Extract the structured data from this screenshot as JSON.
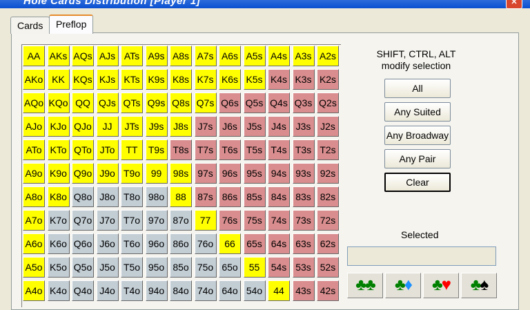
{
  "window": {
    "title": "Hole Cards Distribution [Player 1]",
    "close_glyph": "✕"
  },
  "tabs": [
    {
      "label": "Cards"
    },
    {
      "label": "Preflop"
    }
  ],
  "hint": {
    "line1": "SHIFT, CTRL, ALT",
    "line2": "modify selection"
  },
  "buttons": {
    "all": "All",
    "any_suited": "Any Suited",
    "any_broadway": "Any Broadway",
    "any_pair": "Any Pair",
    "clear": "Clear"
  },
  "selected_label": "Selected",
  "selected_value": "",
  "suit_buttons": [
    {
      "a": "♣",
      "b": "♣",
      "a_color": "#008000",
      "b_color": "#008000"
    },
    {
      "a": "♣",
      "b": "♦",
      "a_color": "#008000",
      "b_color": "#1e90ff"
    },
    {
      "a": "♣",
      "b": "♥",
      "a_color": "#008000",
      "b_color": "#ff0000"
    },
    {
      "a": "♣",
      "b": "♠",
      "a_color": "#008000",
      "b_color": "#000000"
    }
  ],
  "colors": {
    "selected": "#ffff00",
    "suited": "#d98d8e",
    "offsuit": "#c2cdd4"
  },
  "grid": [
    [
      [
        "AA",
        "y"
      ],
      [
        "AKs",
        "y"
      ],
      [
        "AQs",
        "y"
      ],
      [
        "AJs",
        "y"
      ],
      [
        "ATs",
        "y"
      ],
      [
        "A9s",
        "y"
      ],
      [
        "A8s",
        "y"
      ],
      [
        "A7s",
        "y"
      ],
      [
        "A6s",
        "y"
      ],
      [
        "A5s",
        "y"
      ],
      [
        "A4s",
        "y"
      ],
      [
        "A3s",
        "y"
      ],
      [
        "A2s",
        "y"
      ]
    ],
    [
      [
        "AKo",
        "y"
      ],
      [
        "KK",
        "y"
      ],
      [
        "KQs",
        "y"
      ],
      [
        "KJs",
        "y"
      ],
      [
        "KTs",
        "y"
      ],
      [
        "K9s",
        "y"
      ],
      [
        "K8s",
        "y"
      ],
      [
        "K7s",
        "y"
      ],
      [
        "K6s",
        "y"
      ],
      [
        "K5s",
        "y"
      ],
      [
        "K4s",
        "p"
      ],
      [
        "K3s",
        "p"
      ],
      [
        "K2s",
        "p"
      ]
    ],
    [
      [
        "AQo",
        "y"
      ],
      [
        "KQo",
        "y"
      ],
      [
        "QQ",
        "y"
      ],
      [
        "QJs",
        "y"
      ],
      [
        "QTs",
        "y"
      ],
      [
        "Q9s",
        "y"
      ],
      [
        "Q8s",
        "y"
      ],
      [
        "Q7s",
        "y"
      ],
      [
        "Q6s",
        "p"
      ],
      [
        "Q5s",
        "p"
      ],
      [
        "Q4s",
        "p"
      ],
      [
        "Q3s",
        "p"
      ],
      [
        "Q2s",
        "p"
      ]
    ],
    [
      [
        "AJo",
        "y"
      ],
      [
        "KJo",
        "y"
      ],
      [
        "QJo",
        "y"
      ],
      [
        "JJ",
        "y"
      ],
      [
        "JTs",
        "y"
      ],
      [
        "J9s",
        "y"
      ],
      [
        "J8s",
        "y"
      ],
      [
        "J7s",
        "p"
      ],
      [
        "J6s",
        "p"
      ],
      [
        "J5s",
        "p"
      ],
      [
        "J4s",
        "p"
      ],
      [
        "J3s",
        "p"
      ],
      [
        "J2s",
        "p"
      ]
    ],
    [
      [
        "ATo",
        "y"
      ],
      [
        "KTo",
        "y"
      ],
      [
        "QTo",
        "y"
      ],
      [
        "JTo",
        "y"
      ],
      [
        "TT",
        "y"
      ],
      [
        "T9s",
        "y"
      ],
      [
        "T8s",
        "p"
      ],
      [
        "T7s",
        "p"
      ],
      [
        "T6s",
        "p"
      ],
      [
        "T5s",
        "p"
      ],
      [
        "T4s",
        "p"
      ],
      [
        "T3s",
        "p"
      ],
      [
        "T2s",
        "p"
      ]
    ],
    [
      [
        "A9o",
        "y"
      ],
      [
        "K9o",
        "y"
      ],
      [
        "Q9o",
        "y"
      ],
      [
        "J9o",
        "y"
      ],
      [
        "T9o",
        "y"
      ],
      [
        "99",
        "y"
      ],
      [
        "98s",
        "y"
      ],
      [
        "97s",
        "p"
      ],
      [
        "96s",
        "p"
      ],
      [
        "95s",
        "p"
      ],
      [
        "94s",
        "p"
      ],
      [
        "93s",
        "p"
      ],
      [
        "92s",
        "p"
      ]
    ],
    [
      [
        "A8o",
        "y"
      ],
      [
        "K8o",
        "y"
      ],
      [
        "Q8o",
        "g"
      ],
      [
        "J8o",
        "g"
      ],
      [
        "T8o",
        "g"
      ],
      [
        "98o",
        "g"
      ],
      [
        "88",
        "y"
      ],
      [
        "87s",
        "p"
      ],
      [
        "86s",
        "p"
      ],
      [
        "85s",
        "p"
      ],
      [
        "84s",
        "p"
      ],
      [
        "83s",
        "p"
      ],
      [
        "82s",
        "p"
      ]
    ],
    [
      [
        "A7o",
        "y"
      ],
      [
        "K7o",
        "g"
      ],
      [
        "Q7o",
        "g"
      ],
      [
        "J7o",
        "g"
      ],
      [
        "T7o",
        "g"
      ],
      [
        "97o",
        "g"
      ],
      [
        "87o",
        "g"
      ],
      [
        "77",
        "y"
      ],
      [
        "76s",
        "p"
      ],
      [
        "75s",
        "p"
      ],
      [
        "74s",
        "p"
      ],
      [
        "73s",
        "p"
      ],
      [
        "72s",
        "p"
      ]
    ],
    [
      [
        "A6o",
        "y"
      ],
      [
        "K6o",
        "g"
      ],
      [
        "Q6o",
        "g"
      ],
      [
        "J6o",
        "g"
      ],
      [
        "T6o",
        "g"
      ],
      [
        "96o",
        "g"
      ],
      [
        "86o",
        "g"
      ],
      [
        "76o",
        "g"
      ],
      [
        "66",
        "y"
      ],
      [
        "65s",
        "p"
      ],
      [
        "64s",
        "p"
      ],
      [
        "63s",
        "p"
      ],
      [
        "62s",
        "p"
      ]
    ],
    [
      [
        "A5o",
        "y"
      ],
      [
        "K5o",
        "g"
      ],
      [
        "Q5o",
        "g"
      ],
      [
        "J5o",
        "g"
      ],
      [
        "T5o",
        "g"
      ],
      [
        "95o",
        "g"
      ],
      [
        "85o",
        "g"
      ],
      [
        "75o",
        "g"
      ],
      [
        "65o",
        "g"
      ],
      [
        "55",
        "y"
      ],
      [
        "54s",
        "p"
      ],
      [
        "53s",
        "p"
      ],
      [
        "52s",
        "p"
      ]
    ],
    [
      [
        "A4o",
        "y"
      ],
      [
        "K4o",
        "g"
      ],
      [
        "Q4o",
        "g"
      ],
      [
        "J4o",
        "g"
      ],
      [
        "T4o",
        "g"
      ],
      [
        "94o",
        "g"
      ],
      [
        "84o",
        "g"
      ],
      [
        "74o",
        "g"
      ],
      [
        "64o",
        "g"
      ],
      [
        "54o",
        "g"
      ],
      [
        "44",
        "y"
      ],
      [
        "43s",
        "p"
      ],
      [
        "42s",
        "p"
      ]
    ]
  ]
}
